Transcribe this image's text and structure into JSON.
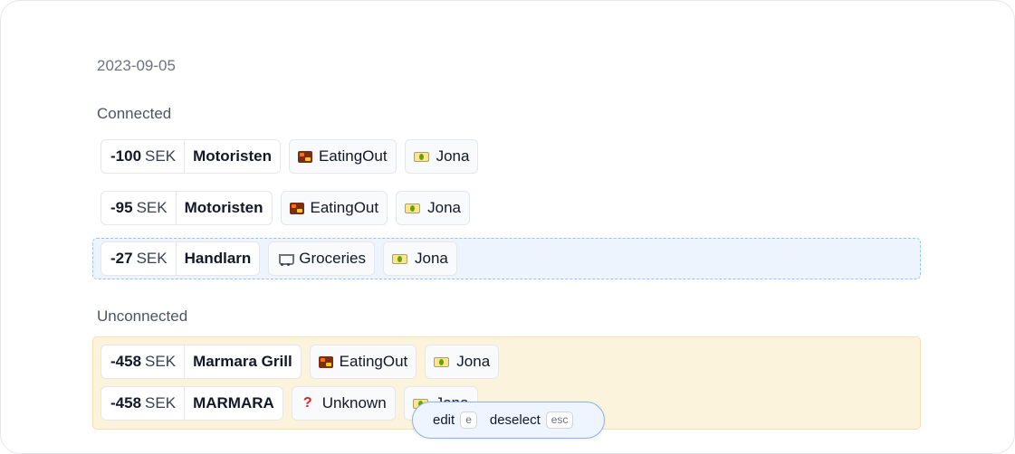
{
  "date": "2023-09-05",
  "sections": {
    "connected_title": "Connected",
    "unconnected_title": "Unconnected"
  },
  "connected": [
    {
      "amount": "-100",
      "currency": "SEK",
      "merchant": "Motoristen",
      "category": "EatingOut",
      "category_icon": "bento-icon",
      "account": "Jona",
      "account_icon": "banknote-icon"
    },
    {
      "amount": "-95",
      "currency": "SEK",
      "merchant": "Motoristen",
      "category": "EatingOut",
      "category_icon": "bento-icon",
      "account": "Jona",
      "account_icon": "banknote-icon"
    },
    {
      "amount": "-27",
      "currency": "SEK",
      "merchant": "Handlarn",
      "category": "Groceries",
      "category_icon": "cart-icon",
      "account": "Jona",
      "account_icon": "banknote-icon",
      "selected": true
    }
  ],
  "unconnected": [
    {
      "amount": "-458",
      "currency": "SEK",
      "merchant": "Marmara Grill",
      "category": "EatingOut",
      "category_icon": "bento-icon",
      "account": "Jona",
      "account_icon": "banknote-icon"
    },
    {
      "amount": "-458",
      "currency": "SEK",
      "merchant": "MARMARA",
      "category": "Unknown",
      "category_icon": "question-mark-icon",
      "account": "Jona",
      "account_icon": "banknote-icon"
    }
  ],
  "toolbar": {
    "edit_label": "edit",
    "edit_key": "e",
    "deselect_label": "deselect",
    "deselect_key": "esc"
  },
  "colors": {
    "selected_bg": "#eef4fd",
    "selected_border": "#93c5fd",
    "unconnected_bg": "#fcf3dc",
    "toolbar_border": "#8fb3de"
  }
}
